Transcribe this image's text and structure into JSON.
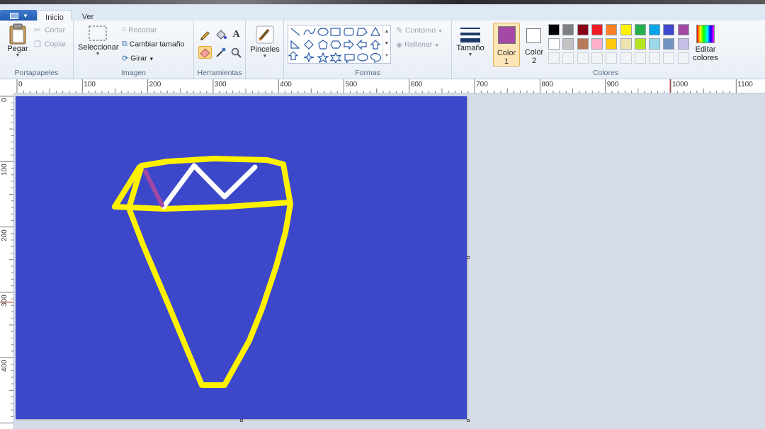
{
  "tabs": {
    "home": "Inicio",
    "view": "Ver"
  },
  "groups": {
    "clipboard": {
      "label": "Portapapeles",
      "paste": "Pegar",
      "cut": "Cortar",
      "copy": "Copiar"
    },
    "image": {
      "label": "Imagen",
      "select": "Seleccionar",
      "crop": "Recortar",
      "resize": "Cambiar tamaño",
      "rotate": "Girar"
    },
    "tools": {
      "label": "Herramientas"
    },
    "brushes": {
      "label": "Pinceles"
    },
    "shapes": {
      "label": "Formas",
      "outline": "Contorno",
      "fill": "Rellenar"
    },
    "size": {
      "label": "Tamaño"
    },
    "colors": {
      "label": "Colores",
      "color1_line1": "Color",
      "color1_line2": "1",
      "color2_line1": "Color",
      "color2_line2": "2",
      "edit_line1": "Editar",
      "edit_line2": "colores",
      "color1_value": "#a349a4",
      "color2_value": "#ffffff",
      "palette_row1": [
        "#000000",
        "#7f7f7f",
        "#880015",
        "#ed1c24",
        "#ff7f27",
        "#fff200",
        "#22b14c",
        "#00a2e8",
        "#3f48cc",
        "#a349a4"
      ],
      "palette_row2": [
        "#ffffff",
        "#c3c3c3",
        "#b97a57",
        "#ffaec9",
        "#ffc90e",
        "#efe4b0",
        "#b5e61d",
        "#99d9ea",
        "#7092be",
        "#c8bfe7"
      ]
    }
  },
  "ruler": {
    "h_labels": [
      "0",
      "100",
      "200",
      "300",
      "400",
      "500",
      "600",
      "700",
      "800",
      "900",
      "1000",
      "1100"
    ],
    "v_labels": [
      "0",
      "100",
      "200",
      "300",
      "400"
    ]
  },
  "canvas": {
    "background": "#3c48c9",
    "stroke_yellow": "#fff200",
    "stroke_white": "#ffffff",
    "stroke_purple": "#a349a4"
  }
}
